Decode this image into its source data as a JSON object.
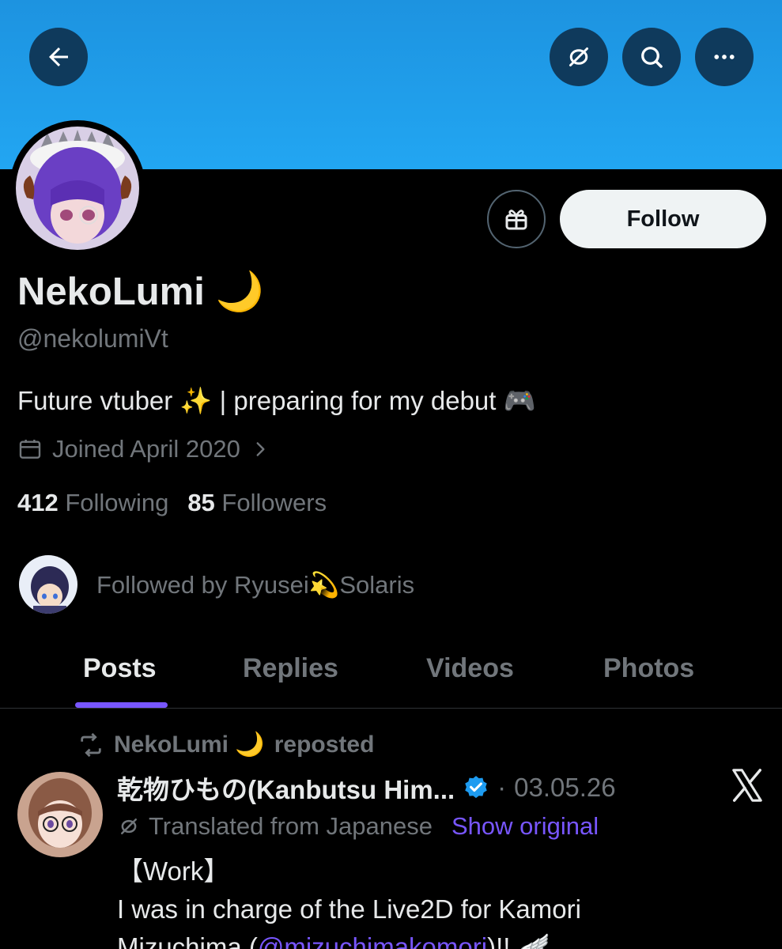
{
  "header": {
    "back_icon": "arrow-left-icon",
    "translate_icon": "translate-off-icon",
    "search_icon": "search-icon",
    "more_icon": "more-horizontal-icon",
    "banner_color": "#1d9bf0"
  },
  "profile": {
    "display_name": "NekoLumi 🌙",
    "handle": "@nekolumiVt",
    "bio": "Future vtuber ✨ | preparing for my debut 🎮",
    "joined": "Joined April 2020",
    "following_count": "412",
    "following_label": "Following",
    "followers_count": "85",
    "followers_label": "Followers",
    "followed_by": "Followed by Ryusei💫Solaris",
    "follow_label": "Follow"
  },
  "tabs": [
    {
      "label": "Posts",
      "active": true
    },
    {
      "label": "Replies",
      "active": false
    },
    {
      "label": "Videos",
      "active": false
    },
    {
      "label": "Photos",
      "active": false
    }
  ],
  "post": {
    "repost_by": "NekoLumi 🌙",
    "repost_label": "reposted",
    "author": "乾物ひもの(Kanbutsu Him...",
    "separator": "·",
    "date": "03.05.26",
    "translated_label": "Translated from Japanese",
    "show_original": "Show original",
    "body_line1": "【Work】",
    "body_line2": "I was in charge of the Live2D for Kamori",
    "body_line3_prefix": "Mizuchima (",
    "mention": "@mizuchimakomori",
    "body_line3_suffix": ")!! 🪽"
  },
  "colors": {
    "accent": "#7856ff",
    "muted": "#71767b",
    "verified": "#1d9bf0"
  }
}
